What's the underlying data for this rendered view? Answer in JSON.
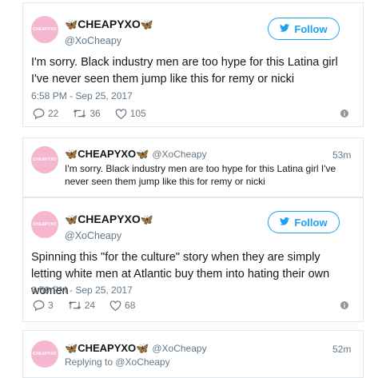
{
  "tweet1": {
    "name": "CHEAPYXO",
    "handle": "@XoCheapy",
    "follow_label": "Follow",
    "text": "I'm sorry. Black industry men are too hype for this Latina girl I've never seen them jump like this for remy or nicki",
    "timestamp": "6:58 PM - Sep 25, 2017",
    "replies": "22",
    "retweets": "36",
    "likes": "105"
  },
  "reply1": {
    "name": "CHEAPYXO",
    "handle": "@XoCheapy",
    "age": "53m",
    "text": "I'm sorry. Black industry men are too hype for this Latina girl I've never seen them jump like this for remy or nicki"
  },
  "tweet2": {
    "name": "CHEAPYXO",
    "handle": "@XoCheapy",
    "follow_label": "Follow",
    "text": "Spinning this \"for the culture\" story when they are simply letting white men at Atlantic buy them into hating their own women",
    "timestamp": "6:59 PM - Sep 25, 2017",
    "replies": "3",
    "retweets": "24",
    "likes": "68"
  },
  "reply2": {
    "name": "CHEAPYXO",
    "handle": "@XoCheapy",
    "age": "52m",
    "replying_to": "Replying to @XoCheapy"
  },
  "colors": {
    "accent": "#1da1f2",
    "avatar": "#f6b6cf",
    "muted": "#657786"
  },
  "icons": [
    "butterfly-icon",
    "twitter-bird-icon",
    "reply-icon",
    "retweet-icon",
    "like-icon",
    "info-icon"
  ]
}
